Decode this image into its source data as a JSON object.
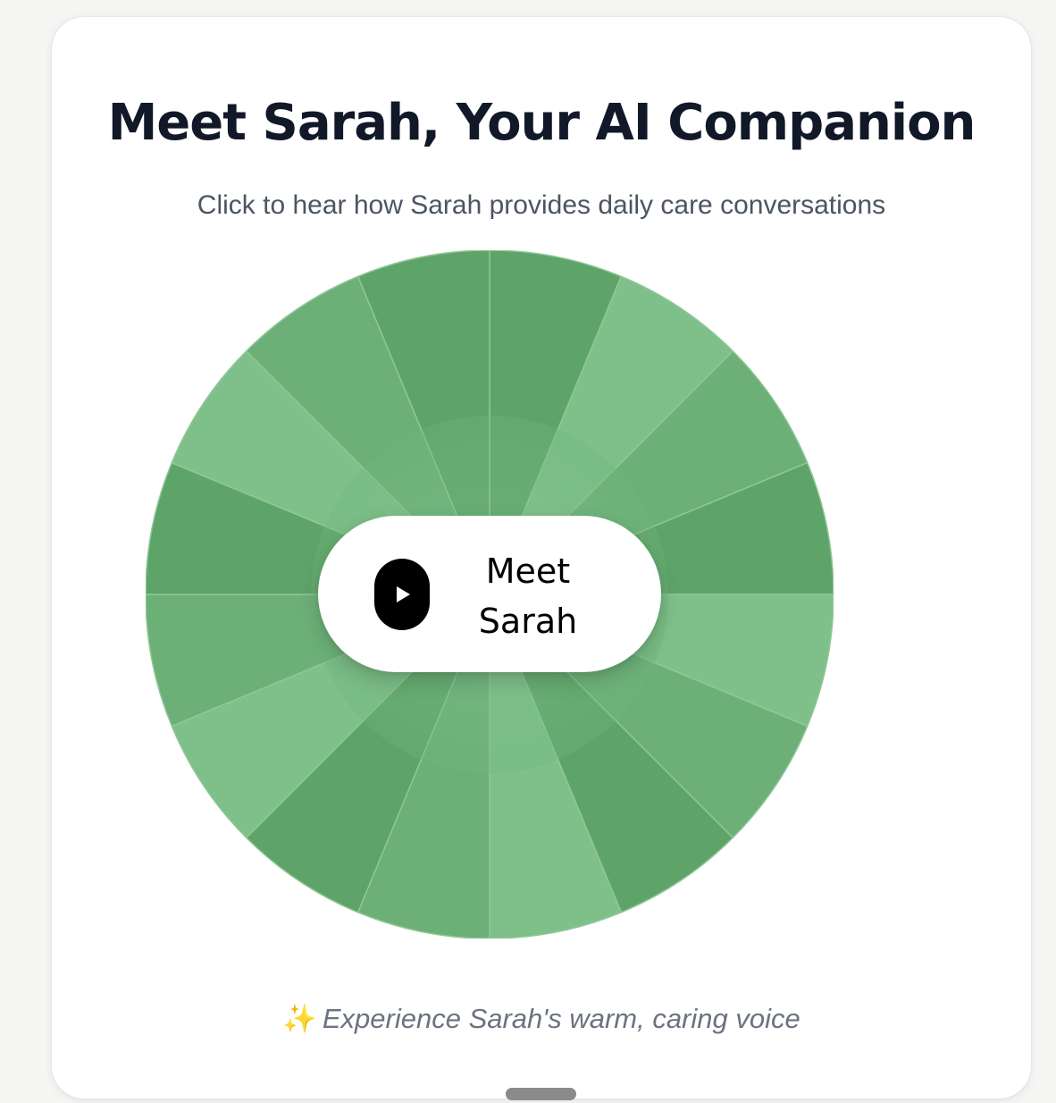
{
  "card": {
    "title": "Meet Sarah, Your AI Companion",
    "subtitle": "Click to hear how Sarah provides daily care conversations",
    "footnote": "Experience Sarah's warm, caring voice",
    "footnote_icon": "sparkles-icon"
  },
  "player": {
    "button_label": "Meet Sarah",
    "icon": "play-icon"
  },
  "wheel": {
    "segments": 16,
    "colors": {
      "light": "#7fc08a",
      "dark": "#5ea468",
      "line": "#8fc797"
    }
  }
}
